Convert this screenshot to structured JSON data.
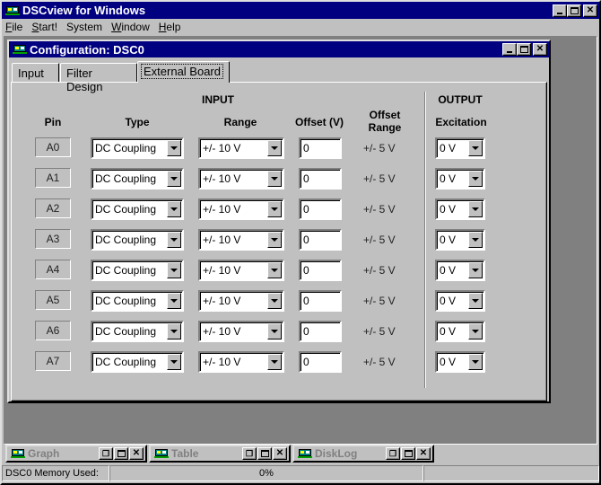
{
  "app": {
    "title": "DSCview for Windows"
  },
  "menu": [
    {
      "label": "File",
      "u": "F",
      "rest": "ile"
    },
    {
      "label": "Start!",
      "u": "S",
      "rest": "tart!"
    },
    {
      "label": "System",
      "u": "",
      "rest": "System"
    },
    {
      "label": "Window",
      "u": "W",
      "rest": "indow"
    },
    {
      "label": "Help",
      "u": "H",
      "rest": "elp"
    }
  ],
  "config": {
    "title": "Configuration: DSC0",
    "tabs": [
      "Input",
      "Filter Design",
      "External Board"
    ],
    "active_tab": "External Board",
    "headers": {
      "input": "INPUT",
      "output": "OUTPUT",
      "pin": "Pin",
      "type": "Type",
      "range": "Range",
      "offset": "Offset (V)",
      "offset_range_1": "Offset",
      "offset_range_2": "Range",
      "excitation": "Excitation"
    },
    "rows": [
      {
        "pin": "A0",
        "type": "DC Coupling",
        "range": "+/- 10 V",
        "offset": "0",
        "offset_range": "+/- 5 V",
        "excitation": "0 V"
      },
      {
        "pin": "A1",
        "type": "DC Coupling",
        "range": "+/- 10 V",
        "offset": "0",
        "offset_range": "+/- 5 V",
        "excitation": "0 V"
      },
      {
        "pin": "A2",
        "type": "DC Coupling",
        "range": "+/- 10 V",
        "offset": "0",
        "offset_range": "+/- 5 V",
        "excitation": "0 V"
      },
      {
        "pin": "A3",
        "type": "DC Coupling",
        "range": "+/- 10 V",
        "offset": "0",
        "offset_range": "+/- 5 V",
        "excitation": "0 V"
      },
      {
        "pin": "A4",
        "type": "DC Coupling",
        "range": "+/- 10 V",
        "offset": "0",
        "offset_range": "+/- 5 V",
        "excitation": "0 V"
      },
      {
        "pin": "A5",
        "type": "DC Coupling",
        "range": "+/- 10 V",
        "offset": "0",
        "offset_range": "+/- 5 V",
        "excitation": "0 V"
      },
      {
        "pin": "A6",
        "type": "DC Coupling",
        "range": "+/- 10 V",
        "offset": "0",
        "offset_range": "+/- 5 V",
        "excitation": "0 V"
      },
      {
        "pin": "A7",
        "type": "DC Coupling",
        "range": "+/- 10 V",
        "offset": "0",
        "offset_range": "+/- 5 V",
        "excitation": "0 V"
      }
    ]
  },
  "minimized": [
    {
      "label": "Graph"
    },
    {
      "label": "Table"
    },
    {
      "label": "DiskLog"
    }
  ],
  "status": {
    "label": "DSC0 Memory Used:",
    "value": "0%",
    "extra": ""
  },
  "colors": {
    "titlebar": "#000080",
    "face": "#c0c0c0",
    "mdi_bg": "#808080"
  }
}
